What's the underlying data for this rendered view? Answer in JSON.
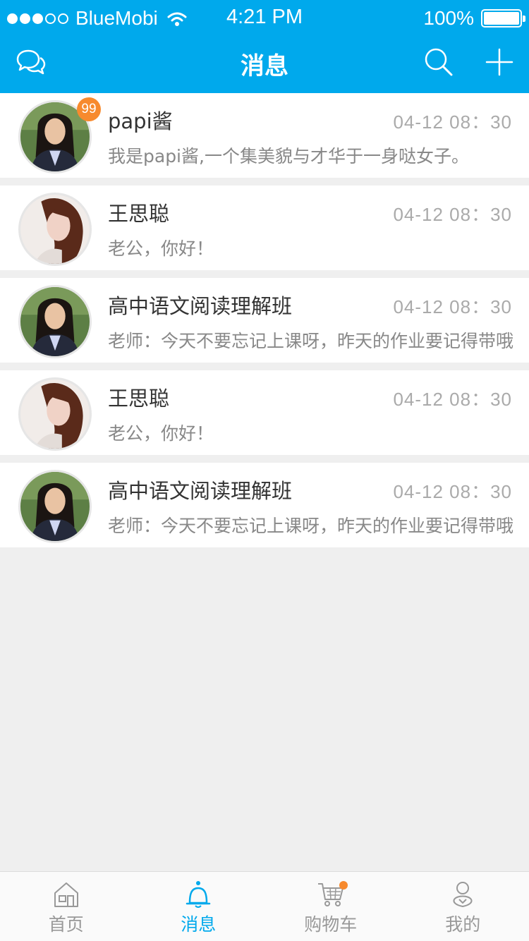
{
  "status_bar": {
    "carrier": "BlueMobi",
    "time": "4:21 PM",
    "battery": "100%",
    "signal_bars_filled": 3,
    "signal_bars_total": 5
  },
  "nav": {
    "title": "消息",
    "left_icon": "chat-bubbles-icon",
    "right_icons": [
      "search-icon",
      "plus-icon"
    ]
  },
  "colors": {
    "primary": "#00a9ec",
    "badge": "#f78a2e",
    "background": "#efefef"
  },
  "messages": [
    {
      "name": "papi酱",
      "time": "04-12   08：30",
      "preview": "我是papi酱,一个集美貌与才华于一身哒女子。",
      "badge": "99",
      "avatar": "woman-suit"
    },
    {
      "name": "王思聪",
      "time": "04-12   08：30",
      "preview": "老公，你好！",
      "badge": "",
      "avatar": "woman-red-hair"
    },
    {
      "name": "高中语文阅读理解班",
      "time": "04-12   08：30",
      "preview": "老师：今天不要忘记上课呀，昨天的作业要记得带哦",
      "badge": "",
      "avatar": "woman-suit"
    },
    {
      "name": "王思聪",
      "time": "04-12   08：30",
      "preview": "老公，你好！",
      "badge": "",
      "avatar": "woman-red-hair"
    },
    {
      "name": "高中语文阅读理解班",
      "time": "04-12   08：30",
      "preview": "老师：今天不要忘记上课呀，昨天的作业要记得带哦",
      "badge": "",
      "avatar": "woman-suit"
    }
  ],
  "tabbar": {
    "tabs": [
      {
        "label": "首页",
        "icon": "home-icon",
        "active": false
      },
      {
        "label": "消息",
        "icon": "bell-icon",
        "active": true
      },
      {
        "label": "购物车",
        "icon": "cart-icon",
        "active": false
      },
      {
        "label": "我的",
        "icon": "user-icon",
        "active": false
      }
    ]
  }
}
